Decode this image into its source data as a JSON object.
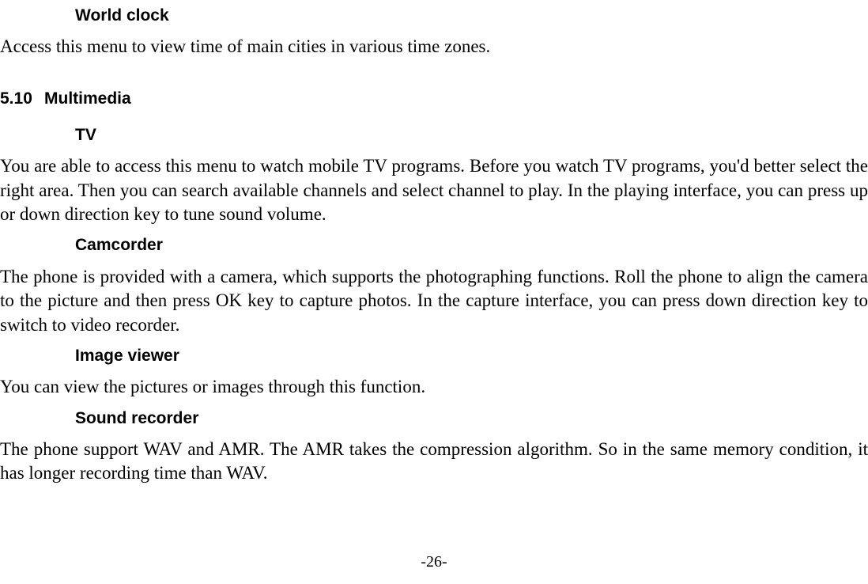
{
  "sections": {
    "worldclock": {
      "title": "World clock",
      "body": "Access this menu to view time of main cities in various time zones."
    },
    "multimedia": {
      "number": "5.10",
      "title": "Multimedia"
    },
    "tv": {
      "title": "TV",
      "body": "You are able to access this menu to watch mobile TV programs. Before you watch TV programs, you'd better select the right area. Then you can search available channels and select channel to play. In the playing interface, you can press up or down direction key to tune sound volume."
    },
    "camcorder": {
      "title": "Camcorder",
      "body": "The phone is provided with a camera, which supports the photographing functions. Roll the phone to align the camera to the picture and then press OK key to capture photos. In the capture interface, you can press down direction key to switch to video recorder."
    },
    "imageviewer": {
      "title": "Image viewer",
      "body": "You can view the pictures or images through this function."
    },
    "soundrecorder": {
      "title": "Sound recorder",
      "body": "The phone support WAV and AMR. The AMR takes the compression algorithm. So in the same memory condition, it has longer recording time than WAV."
    }
  },
  "page_number": "-26-"
}
